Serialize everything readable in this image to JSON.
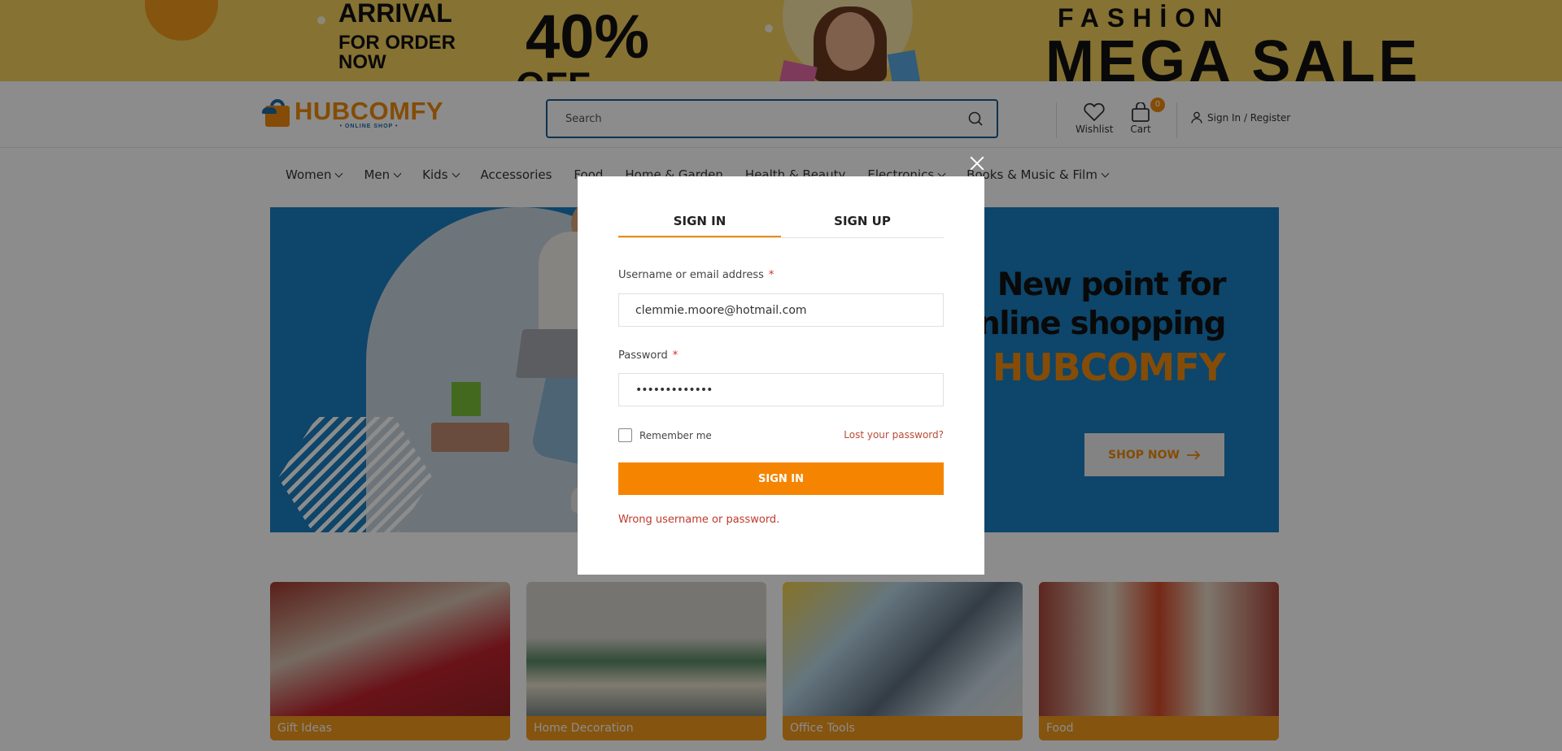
{
  "promo": {
    "arrival": "ARRIVAL",
    "for_order": "FOR ORDER NOW",
    "discount": "40%",
    "off": "OFF",
    "fashion": "FASHİON",
    "mega_sale": "MEGA SALE",
    "background": "#f5cf5c"
  },
  "header": {
    "logo_name": "HUBCOMFY",
    "logo_sub": "• ONLINE SHOP •",
    "search_placeholder": "Search",
    "wishlist_label": "Wishlist",
    "cart_label": "Cart",
    "cart_count": "0",
    "signin_label": "Sign In / Register"
  },
  "nav": {
    "items": [
      {
        "label": "Women"
      },
      {
        "label": "Men"
      },
      {
        "label": "Kids"
      },
      {
        "label": "Accessories"
      },
      {
        "label": "Food"
      },
      {
        "label": "Home & Garden"
      },
      {
        "label": "Health & Beauty"
      },
      {
        "label": "Electronics"
      },
      {
        "label": "Books & Music & Film"
      }
    ]
  },
  "hero": {
    "line1": "New point for",
    "line2": "online shopping",
    "brand": "HUBCOMFY",
    "cta": "SHOP NOW",
    "background": "#1a7fc2"
  },
  "categories": [
    {
      "label": "Gift Ideas"
    },
    {
      "label": "Home Decoration"
    },
    {
      "label": "Office Tools"
    },
    {
      "label": "Food"
    }
  ],
  "modal": {
    "tab_signin": "SIGN IN",
    "tab_signup": "SIGN UP",
    "username_label": "Username or email address",
    "username_value": "clemmie.moore@hotmail.com",
    "password_label": "Password",
    "password_value": "•••••••••••••",
    "required_mark": "*",
    "remember_label": "Remember me",
    "lost_password": "Lost your password?",
    "submit": "SIGN IN",
    "error": "Wrong username or password."
  },
  "colors": {
    "accent": "#f08a0b",
    "brand_blue": "#1b6aa8",
    "error": "#c0392b"
  }
}
